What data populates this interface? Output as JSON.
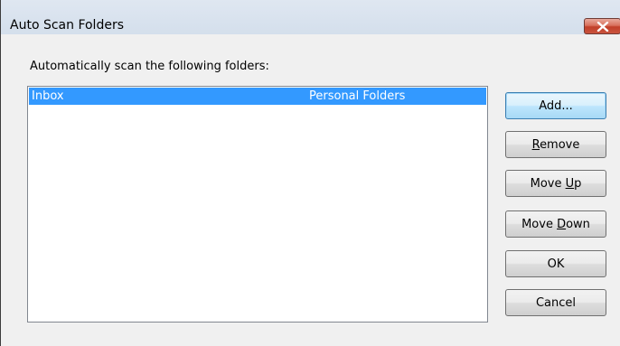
{
  "window": {
    "title": "Auto Scan Folders",
    "close_icon": "close-x-icon"
  },
  "prompt_label": "Automatically scan the following folders:",
  "folders": [
    {
      "name": "Inbox",
      "store": "Personal Folders",
      "selected": true
    }
  ],
  "buttons": {
    "add": "Add...",
    "remove": {
      "pre": "",
      "key": "R",
      "post": "emove"
    },
    "move_up": {
      "pre": "Move ",
      "key": "U",
      "post": "p"
    },
    "move_down": {
      "pre": "Move ",
      "key": "D",
      "post": "own"
    },
    "ok": "OK",
    "cancel": "Cancel"
  },
  "colors": {
    "selection": "#3399ff",
    "close_button": "#c13f29"
  }
}
